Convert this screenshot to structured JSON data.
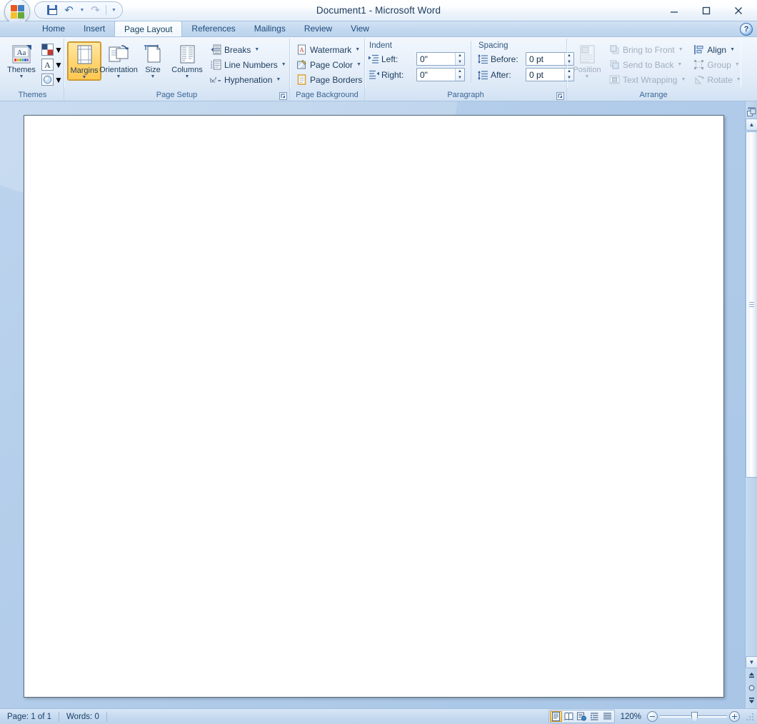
{
  "window": {
    "title": "Document1 - Microsoft Word",
    "office_button": "office-orb",
    "minimize_label": "Minimize",
    "maximize_label": "Maximize",
    "close_label": "Close"
  },
  "quick_access": {
    "items": [
      {
        "name": "save",
        "label": "Save",
        "icon": "floppy-disk-icon"
      },
      {
        "name": "undo",
        "label": "Undo",
        "icon": "undo-arrow-icon",
        "has_dropdown": true
      },
      {
        "name": "redo",
        "label": "Redo",
        "icon": "redo-arrow-icon"
      }
    ],
    "customize_label": "Customize Quick Access Toolbar",
    "customize_icon": "chevron-down-icon"
  },
  "tabs": [
    {
      "name": "home",
      "label": "Home",
      "active": false
    },
    {
      "name": "insert",
      "label": "Insert",
      "active": false
    },
    {
      "name": "page-layout",
      "label": "Page Layout",
      "active": true
    },
    {
      "name": "references",
      "label": "References",
      "active": false
    },
    {
      "name": "mailings",
      "label": "Mailings",
      "active": false
    },
    {
      "name": "review",
      "label": "Review",
      "active": false
    },
    {
      "name": "view",
      "label": "View",
      "active": false
    }
  ],
  "help": {
    "label": "?",
    "title": "Microsoft Office Word Help"
  },
  "ribbon": {
    "groups": [
      {
        "name": "themes",
        "title": "Themes",
        "big": [
          {
            "name": "themes",
            "label": "Themes",
            "icon": "themes-icon",
            "dropdown": "▼"
          }
        ],
        "swatches": [
          {
            "name": "theme-colors",
            "label": "Theme Colors",
            "icon": "color-swatch-icon"
          },
          {
            "name": "theme-fonts",
            "label": "Theme Fonts",
            "icon": "font-A-icon"
          },
          {
            "name": "theme-effects",
            "label": "Theme Effects",
            "icon": "effects-circle-icon"
          }
        ]
      },
      {
        "name": "page-setup",
        "title": "Page Setup",
        "big": [
          {
            "name": "margins",
            "label": "Margins",
            "icon": "margins-icon",
            "dropdown": "▼",
            "selected": true
          },
          {
            "name": "orientation",
            "label": "Orientation",
            "icon": "orientation-icon",
            "dropdown": "▼",
            "selected": false
          },
          {
            "name": "size",
            "label": "Size",
            "icon": "page-size-icon",
            "dropdown": "▼",
            "selected": false
          },
          {
            "name": "columns",
            "label": "Columns",
            "icon": "columns-icon",
            "dropdown": "▼",
            "selected": false
          }
        ],
        "small": [
          {
            "name": "breaks",
            "label": "Breaks",
            "icon": "breaks-icon",
            "dropdown": "▼"
          },
          {
            "name": "line-numbers",
            "label": "Line Numbers",
            "icon": "line-numbers-icon",
            "dropdown": "▼"
          },
          {
            "name": "hyphenation",
            "label": "Hyphenation",
            "icon": "hyphenation-icon",
            "dropdown": "▼"
          }
        ],
        "dialog_launcher": "Page Setup dialog launcher"
      },
      {
        "name": "page-background",
        "title": "Page Background",
        "small": [
          {
            "name": "watermark",
            "label": "Watermark",
            "icon": "watermark-icon",
            "dropdown": "▼"
          },
          {
            "name": "page-color",
            "label": "Page Color",
            "icon": "page-color-icon",
            "dropdown": "▼"
          },
          {
            "name": "page-borders",
            "label": "Page Borders",
            "icon": "page-borders-icon",
            "dropdown": ""
          }
        ]
      },
      {
        "name": "paragraph",
        "title": "Paragraph",
        "dialog_launcher": "Paragraph dialog launcher",
        "indent": {
          "header": "Indent",
          "fields": [
            {
              "name": "indent-left",
              "label": "Left:",
              "value": "0\"",
              "icon": "indent-left-icon"
            },
            {
              "name": "indent-right",
              "label": "Right:",
              "value": "0\"",
              "icon": "indent-right-icon"
            }
          ]
        },
        "spacing": {
          "header": "Spacing",
          "fields": [
            {
              "name": "spacing-before",
              "label": "Before:",
              "value": "0 pt",
              "icon": "spacing-before-icon"
            },
            {
              "name": "spacing-after",
              "label": "After:",
              "value": "0 pt",
              "icon": "spacing-after-icon"
            }
          ]
        }
      },
      {
        "name": "arrange",
        "title": "Arrange",
        "big": [
          {
            "name": "position",
            "label": "Position",
            "icon": "position-icon",
            "dropdown": "▼",
            "disabled": true
          }
        ],
        "small_col1": [
          {
            "name": "bring-to-front",
            "label": "Bring to Front",
            "icon": "bring-to-front-icon",
            "dropdown": "▼",
            "disabled": true
          },
          {
            "name": "send-to-back",
            "label": "Send to Back",
            "icon": "send-to-back-icon",
            "dropdown": "▼",
            "disabled": true
          },
          {
            "name": "text-wrapping",
            "label": "Text Wrapping",
            "icon": "text-wrapping-icon",
            "dropdown": "▼",
            "disabled": true
          }
        ],
        "small_col2": [
          {
            "name": "align",
            "label": "Align",
            "icon": "align-icon",
            "dropdown": "▼",
            "disabled": false
          },
          {
            "name": "group",
            "label": "Group",
            "icon": "group-icon",
            "dropdown": "▼",
            "disabled": true
          },
          {
            "name": "rotate",
            "label": "Rotate",
            "icon": "rotate-icon",
            "dropdown": "▼",
            "disabled": true
          }
        ]
      }
    ]
  },
  "document": {
    "content": "",
    "page_background": "#ffffff"
  },
  "scrollbar": {
    "scroll_up_label": "Scroll Up",
    "scroll_down_label": "Scroll Down",
    "previous_page_label": "Previous Page",
    "select_browse_object_label": "Select Browse Object",
    "next_page_label": "Next Page",
    "split_label": "Split window",
    "browse_object_label": "Select Browse Object"
  },
  "statusbar": {
    "page": "Page: 1 of 1",
    "words": "Words: 0",
    "views": [
      {
        "name": "print-layout",
        "label": "Print Layout",
        "icon": "print-layout-icon",
        "active": true
      },
      {
        "name": "full-screen-reading",
        "label": "Full Screen Reading",
        "icon": "reading-view-icon",
        "active": false
      },
      {
        "name": "web-layout",
        "label": "Web Layout",
        "icon": "web-layout-icon",
        "active": false
      },
      {
        "name": "outline",
        "label": "Outline",
        "icon": "outline-view-icon",
        "active": false
      },
      {
        "name": "draft",
        "label": "Draft",
        "icon": "draft-view-icon",
        "active": false
      }
    ],
    "zoom_level": "120%",
    "zoom_out_label": "Zoom Out",
    "zoom_in_label": "Zoom In",
    "zoom_out_glyph": "−",
    "zoom_in_glyph": "+"
  },
  "colors": {
    "accent": "#ffc74e",
    "ribbon_bg": "#e8f0fa",
    "title_text": "#1b3a5c",
    "group_title": "#3a6594",
    "doc_bg": "#b3cdea",
    "page": "#ffffff",
    "disabled_text": "#a0aebd"
  }
}
